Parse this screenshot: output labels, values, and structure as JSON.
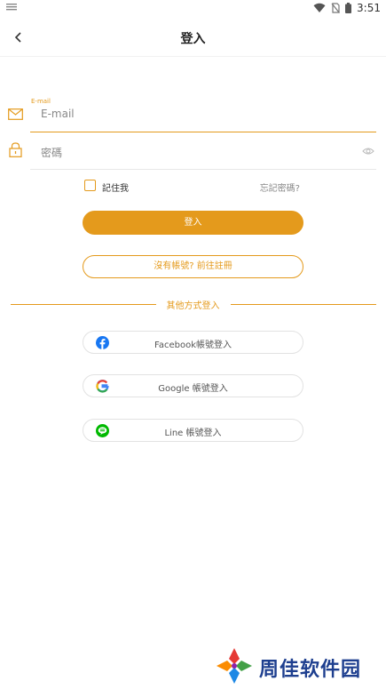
{
  "status_bar": {
    "time": "3:51",
    "icons": [
      "wifi-icon",
      "no-sim-icon",
      "battery-icon"
    ]
  },
  "header": {
    "title": "登入",
    "back_icon": "chevron-left-icon"
  },
  "form": {
    "email": {
      "floating_label": "E-mail",
      "placeholder": "E-mail",
      "icon": "mail-icon"
    },
    "password": {
      "placeholder": "密碼",
      "icon": "lock-icon",
      "toggle_icon": "eye-icon"
    },
    "remember_label": "記住我",
    "remember_checked": false,
    "forgot_label": "忘記密碼?",
    "login_label": "登入",
    "register_label": "沒有帳號? 前往註冊"
  },
  "social": {
    "divider_label": "其他方式登入",
    "buttons": [
      {
        "label": "Facebook帳號登入",
        "icon": "facebook-icon"
      },
      {
        "label": "Google 帳號登入",
        "icon": "google-icon"
      },
      {
        "label": "Line 帳號登入",
        "icon": "line-icon"
      }
    ]
  },
  "watermark": {
    "text": "周佳软件园"
  },
  "colors": {
    "accent": "#e49a1c",
    "border": "#e2e2e2",
    "text": "#333333"
  }
}
